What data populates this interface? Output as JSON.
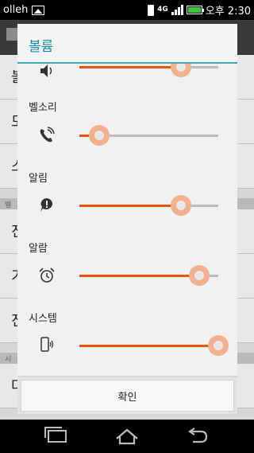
{
  "status_bar": {
    "carrier": "olleh",
    "network": "4G",
    "time": "오후 2:30"
  },
  "background": {
    "rows": [
      "볼",
      "모",
      "스",
      "진",
      "기",
      "진",
      "다"
    ],
    "sections": [
      "벨",
      "시"
    ]
  },
  "dialog": {
    "title": "볼륨",
    "sliders": [
      {
        "label": "",
        "icon": "speaker-icon",
        "level": 0.73
      },
      {
        "label": "벨소리",
        "icon": "ringtone-phone-icon",
        "level": 0.14
      },
      {
        "label": "알림",
        "icon": "notification-bubble-icon",
        "level": 0.73
      },
      {
        "label": "알람",
        "icon": "alarm-clock-icon",
        "level": 0.86
      },
      {
        "label": "시스템",
        "icon": "system-device-icon",
        "level": 1.0
      }
    ],
    "confirm_label": "확인"
  },
  "colors": {
    "accent": "#e8530e",
    "title": "#1b8aa0",
    "title_line": "#3aa7b4"
  },
  "nav_bar": {
    "icons": [
      "recent-apps-icon",
      "home-icon",
      "back-icon"
    ]
  }
}
